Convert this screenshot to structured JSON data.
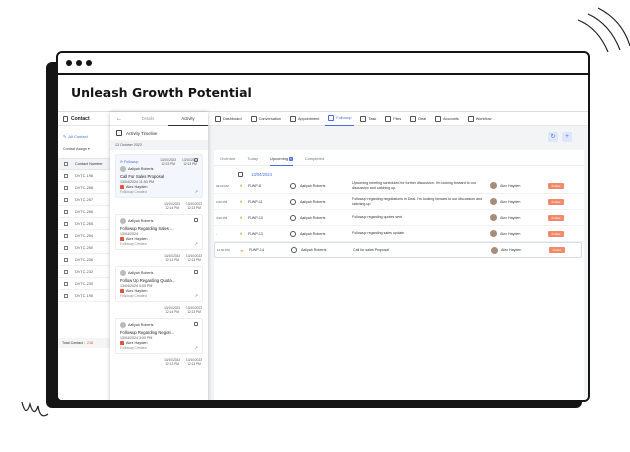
{
  "headline": "Unleash Growth Potential",
  "contacts": {
    "title": "Contact",
    "all_label": "All Contact",
    "select_label": "Contact Assign",
    "column_header": "Contact Number",
    "rows": [
      "DVTC-196",
      "DVTC-258",
      "DVTC-257",
      "DVTC-256",
      "DVTC-255",
      "DVTC-254",
      "DVTC-250",
      "DVTC-236",
      "DVTC-232",
      "DVTC-230",
      "DVTC-195"
    ],
    "total_label": "Total Contact :",
    "total_value": "218"
  },
  "activity": {
    "back": "←",
    "tab_details": "Details",
    "tab_activity": "Activity",
    "timeline_title": "Activity Timeline",
    "date_header": "13 October 2023",
    "first_card": {
      "badge": "Followup",
      "d1": "13/10/2023",
      "t1": "12:23 PM",
      "d2": "13/10/2023",
      "t2": "12:13 PM",
      "name": "Aaliyah Roberts",
      "title": "Call For Sales Proposal",
      "date": "13/04/2024 11:50 PM",
      "owner": "Alex Hayden",
      "created": "Followup Created"
    },
    "cards": [
      {
        "d1": "13/10/2023",
        "t1": "12:14 PM",
        "d2": "13/10/2023",
        "t2": "12:13 PM",
        "name": "Aaliyah Roberts",
        "title": "Followup Regarding Sales ...",
        "date": "13/04/2024",
        "owner": "Alex Hayden",
        "created": "Followup Created"
      },
      {
        "d1": "13/10/2023",
        "t1": "12:14 PM",
        "d2": "13/10/2023",
        "t2": "12:13 PM",
        "name": "Aaliyah Roberts",
        "title": "Follow Up Regarding Quota...",
        "date": "13/04/2024 4:00 PM",
        "owner": "Alex Hayden",
        "created": "Followup Created"
      },
      {
        "d1": "13/10/2023",
        "t1": "12:14 PM",
        "d2": "13/10/2023",
        "t2": "12:13 PM",
        "name": "Aaliyah Roberts",
        "title": "Followup Regarding Negoti...",
        "date": "13/04/2024 3:00 PM",
        "owner": "Alex Hayden",
        "created": "Followup Created"
      }
    ],
    "tail": {
      "d1": "13/10/2023",
      "t1": "12:13 PM",
      "d2": "13/10/2023",
      "t2": "12:13 PM"
    }
  },
  "nav": [
    "Dashboard",
    "Conversation",
    "Appointment",
    "Followup",
    "Task",
    "Files",
    "Deal",
    "Accounts",
    "Workflow"
  ],
  "nav_active": "Followup",
  "actions": {
    "refresh": "↻",
    "add": "+"
  },
  "panel": {
    "tabs": [
      "Overdue",
      "Today",
      "Upcoming",
      "Completed"
    ],
    "upcoming_count": "5",
    "date": "13/04/2024",
    "rows": [
      {
        "time": "09:00 AM",
        "id": "FLWP-8",
        "who": "Aaliyah Roberts",
        "desc": "Upcoming meeting scheduled for further discussion. I'm looking forward to our discussion and catching up.",
        "owner": "Alex Hayden",
        "status": "Follow"
      },
      {
        "time": "2:00 PM",
        "id": "FLWP-11",
        "who": "Aaliyah Roberts",
        "desc": "Followup regarding negotiations in Deal. I'm looking forward to our discussion and catching up.",
        "owner": "Alex Hayden",
        "status": "Follow"
      },
      {
        "time": "4:00 PM",
        "id": "FLWP-10",
        "who": "Aaliyah Roberts",
        "desc": "Followup regarding quotes sent",
        "owner": "Alex Hayden",
        "status": "Follow"
      },
      {
        "time": "-",
        "id": "FLWP-13",
        "who": "Aaliyah Roberts",
        "desc": "Followup regarding sales update",
        "owner": "Alex Hayden",
        "status": "Follow"
      },
      {
        "time": "11:50 PM",
        "id": "FLWP-14",
        "who": "Aaliyah Roberts",
        "desc": "Call for sales Proposal",
        "owner": "Alex Hayden",
        "status": "Follow"
      }
    ]
  },
  "colors": {
    "accent": "#4a6ee0",
    "status": "#f08a6a",
    "frame": "#151515"
  }
}
